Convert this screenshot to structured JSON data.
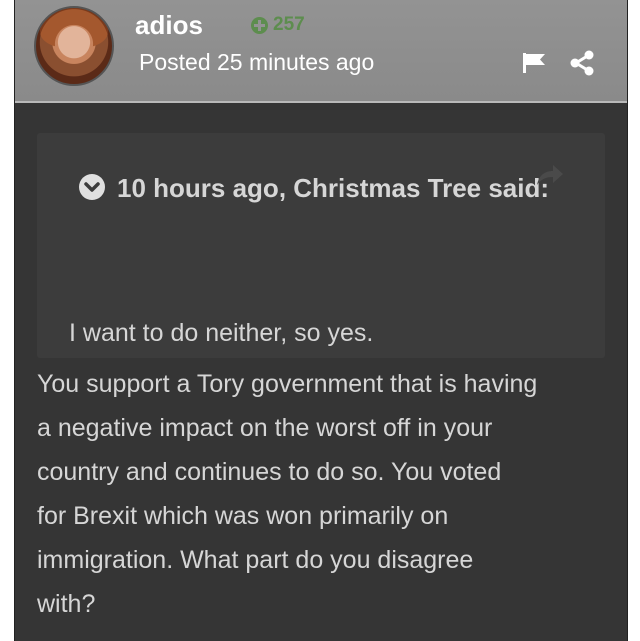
{
  "post": {
    "author": "adios",
    "reputation": "257",
    "posted": "Posted 25 minutes ago",
    "quote": {
      "header": "10 hours ago, Christmas Tree said:",
      "text": "I want to do neither, so yes."
    },
    "body_lines": [
      "You support a Tory government that is having",
      "a negative impact on the worst off in your",
      "country and continues to do so.  You voted",
      "for Brexit which was won primarily on",
      "immigration.  What part do you disagree",
      "with?"
    ]
  },
  "icons": {
    "reputation": "plus-circle-icon",
    "report": "flag-icon",
    "share": "share-icon",
    "quote_toggle": "chevron-down-icon",
    "quote_link": "reply-arrow-icon"
  },
  "colors": {
    "header_bg": "#939393",
    "post_bg": "#353535",
    "quote_bg": "#3c3c3c",
    "reputation": "#5d8d4e",
    "text": "#d6d6d6"
  }
}
